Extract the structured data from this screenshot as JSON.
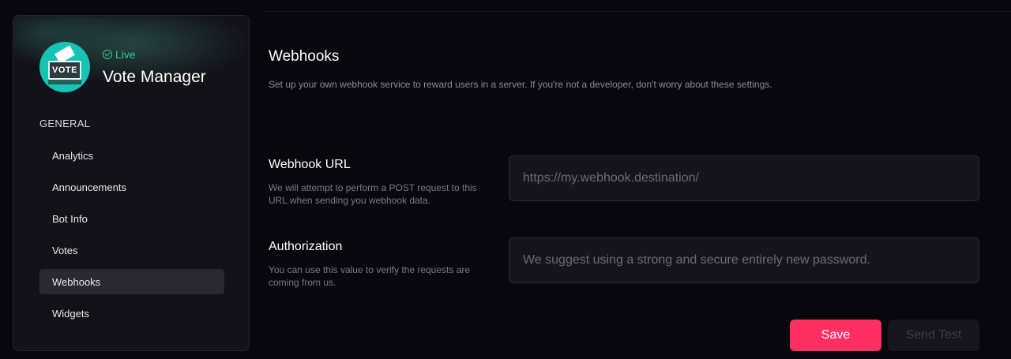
{
  "bot": {
    "status": "Live",
    "name": "Vote Manager",
    "avatar_text": "VOTE"
  },
  "sidebar": {
    "section": "GENERAL",
    "items": [
      {
        "label": "Analytics"
      },
      {
        "label": "Announcements"
      },
      {
        "label": "Bot Info"
      },
      {
        "label": "Votes"
      },
      {
        "label": "Webhooks"
      },
      {
        "label": "Widgets"
      }
    ]
  },
  "main": {
    "title": "Webhooks",
    "description": "Set up your own webhook service to reward users in a server. If you're not a developer, don't worry about these settings.",
    "webhook_url": {
      "label": "Webhook URL",
      "help": "We will attempt to perform a POST request to this URL when sending you webhook data.",
      "value": "",
      "placeholder": "https://my.webhook.destination/"
    },
    "authorization": {
      "label": "Authorization",
      "help": "You can use this value to verify the requests are coming from us.",
      "value": "",
      "placeholder": "We suggest using a strong and secure entirely new password."
    },
    "save_label": "Save",
    "send_test_label": "Send Test"
  },
  "colors": {
    "accent": "#fe2f63",
    "live": "#2bd18b",
    "avatar": "#17c3b2"
  }
}
